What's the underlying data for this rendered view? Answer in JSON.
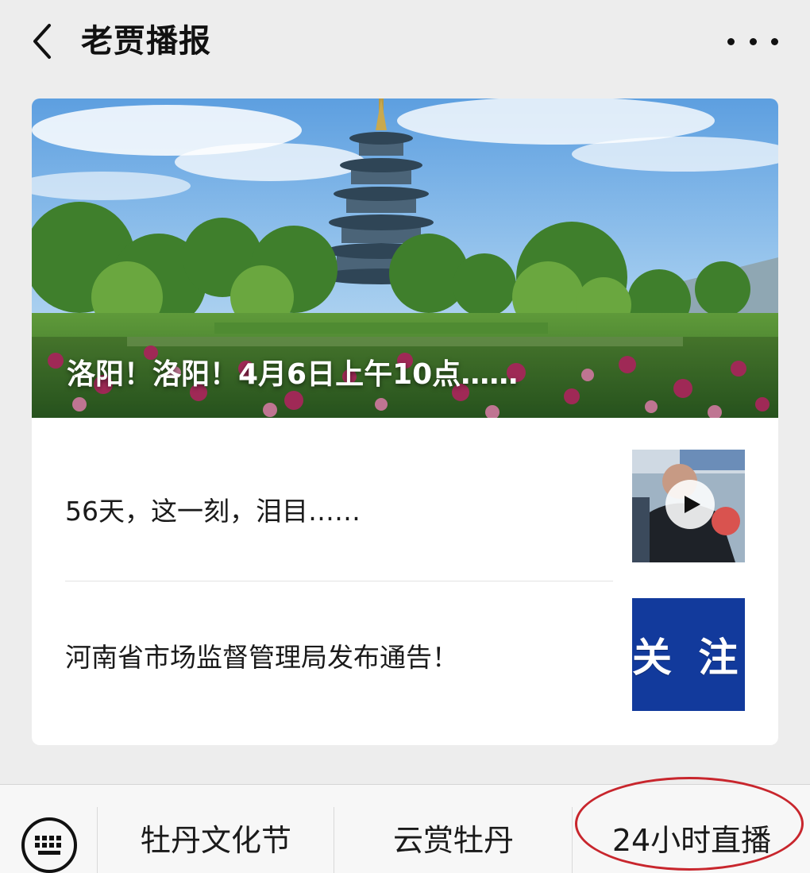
{
  "header": {
    "title": "老贾播报",
    "back_icon": "chevron-left-icon",
    "more_icon": "more-dots-icon"
  },
  "hero": {
    "title": "洛阳！洛阳！4月6日上午10点……"
  },
  "articles": [
    {
      "title": "56天，这一刻，泪目……",
      "thumbnail_type": "video",
      "thumbnail_icon": "play-icon"
    },
    {
      "title": "河南省市场监督管理局发布通告！",
      "thumbnail_text": "关 注",
      "thumbnail_bg": "#123a9c"
    }
  ],
  "bottom_menu": {
    "keyboard_icon": "keyboard-icon",
    "items": [
      {
        "label": "牡丹文化节"
      },
      {
        "label": "云赏牡丹"
      },
      {
        "label": "24小时直播"
      }
    ],
    "highlight_color": "#c8262d"
  }
}
